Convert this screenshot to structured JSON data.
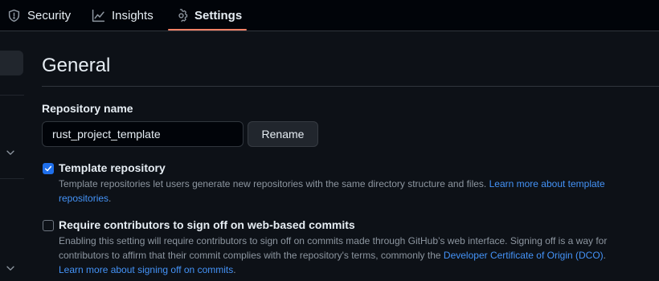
{
  "tabs": [
    {
      "label": "Security",
      "icon": "shield-icon"
    },
    {
      "label": "Insights",
      "icon": "graph-icon"
    },
    {
      "label": "Settings",
      "icon": "gear-icon",
      "selected": true
    }
  ],
  "general": {
    "title": "General",
    "repo_name_label": "Repository name",
    "repo_name_value": "rust_project_template",
    "rename_label": "Rename"
  },
  "template_option": {
    "checked": true,
    "title": "Template repository",
    "description": "Template repositories let users generate new repositories with the same directory structure and files.",
    "link": "Learn more about template repositories",
    "trailing": "."
  },
  "signoff_option": {
    "checked": false,
    "title": "Require contributors to sign off on web-based commits",
    "description": "Enabling this setting will require contributors to sign off on commits made through GitHub’s web interface. Signing off is a way for contributors to affirm that their commit complies with the repository's terms, commonly the",
    "dco_link": "Developer Certificate of Origin (DCO)",
    "after_dco": ".",
    "learn_link": "Learn more about signing off on commits",
    "trailing": "."
  },
  "colors": {
    "background": "#0d1117",
    "accent_underline": "#f78166",
    "link": "#4493f8",
    "checkbox": "#1f6feb"
  }
}
